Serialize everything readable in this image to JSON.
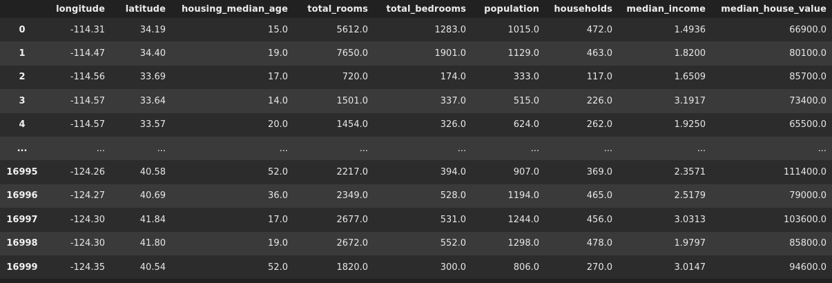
{
  "table": {
    "columns": [
      "",
      "longitude",
      "latitude",
      "housing_median_age",
      "total_rooms",
      "total_bedrooms",
      "population",
      "households",
      "median_income",
      "median_house_value"
    ],
    "rows": [
      [
        "0",
        "-114.31",
        "34.19",
        "15.0",
        "5612.0",
        "1283.0",
        "1015.0",
        "472.0",
        "1.4936",
        "66900.0"
      ],
      [
        "1",
        "-114.47",
        "34.40",
        "19.0",
        "7650.0",
        "1901.0",
        "1129.0",
        "463.0",
        "1.8200",
        "80100.0"
      ],
      [
        "2",
        "-114.56",
        "33.69",
        "17.0",
        "720.0",
        "174.0",
        "333.0",
        "117.0",
        "1.6509",
        "85700.0"
      ],
      [
        "3",
        "-114.57",
        "33.64",
        "14.0",
        "1501.0",
        "337.0",
        "515.0",
        "226.0",
        "3.1917",
        "73400.0"
      ],
      [
        "4",
        "-114.57",
        "33.57",
        "20.0",
        "1454.0",
        "326.0",
        "624.0",
        "262.0",
        "1.9250",
        "65500.0"
      ],
      [
        "...",
        "...",
        "...",
        "...",
        "...",
        "...",
        "...",
        "...",
        "...",
        "..."
      ],
      [
        "16995",
        "-124.26",
        "40.58",
        "52.0",
        "2217.0",
        "394.0",
        "907.0",
        "369.0",
        "2.3571",
        "111400.0"
      ],
      [
        "16996",
        "-124.27",
        "40.69",
        "36.0",
        "2349.0",
        "528.0",
        "1194.0",
        "465.0",
        "2.5179",
        "79000.0"
      ],
      [
        "16997",
        "-124.30",
        "41.84",
        "17.0",
        "2677.0",
        "531.0",
        "1244.0",
        "456.0",
        "3.0313",
        "103600.0"
      ],
      [
        "16998",
        "-124.30",
        "41.80",
        "19.0",
        "2672.0",
        "552.0",
        "1298.0",
        "478.0",
        "1.9797",
        "85800.0"
      ],
      [
        "16999",
        "-124.35",
        "40.54",
        "52.0",
        "1820.0",
        "300.0",
        "806.0",
        "270.0",
        "3.0147",
        "94600.0"
      ]
    ]
  }
}
